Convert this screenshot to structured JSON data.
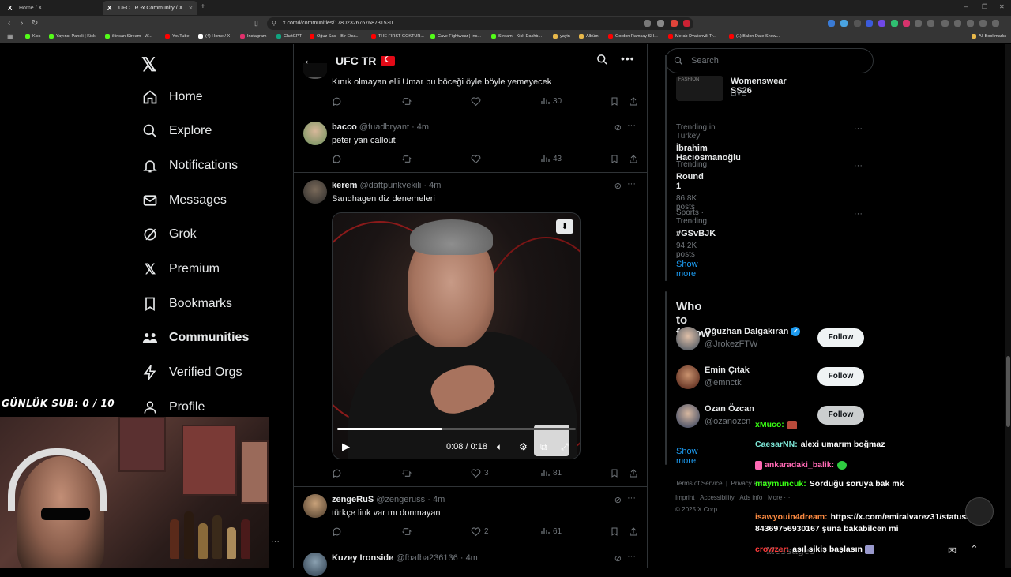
{
  "browser": {
    "tabs": [
      {
        "label": "Home / X",
        "active": false
      },
      {
        "label": "UFC TR •x Community / X",
        "active": true
      }
    ],
    "url": "x.com/i/communities/1780232676768731530",
    "bookmarks": [
      "Kick",
      "Yayıncı Paneli | Kick",
      "ikinsan Stream - W...",
      "YouTube",
      "(4) Home / X",
      "Instagram",
      "ChatGPT",
      "Oğuz Sasi - Bir Efsa...",
      "THE FIRST GOKTUR...",
      "Cave Fightwear | Ins...",
      "Stream - Kick Dashb...",
      "yayin",
      "Albüm",
      "Gordon Ramsay SH...",
      "Merab Dvalishvili Tr...",
      "(1) Balon Date Show...",
      "All Bookmarks"
    ]
  },
  "sidebar": {
    "logo": "𝕏",
    "items": [
      {
        "label": "Home",
        "icon": "home-icon"
      },
      {
        "label": "Explore",
        "icon": "search-icon"
      },
      {
        "label": "Notifications",
        "icon": "bell-icon"
      },
      {
        "label": "Messages",
        "icon": "envelope-icon"
      },
      {
        "label": "Grok",
        "icon": "grok-icon"
      },
      {
        "label": "Premium",
        "icon": "x-icon"
      },
      {
        "label": "Bookmarks",
        "icon": "bookmark-icon"
      },
      {
        "label": "Communities",
        "icon": "people-icon"
      },
      {
        "label": "Verified Orgs",
        "icon": "bolt-icon"
      },
      {
        "label": "Profile",
        "icon": "person-icon"
      }
    ]
  },
  "header": {
    "title": "UFC TR"
  },
  "tweets": [
    {
      "name": "",
      "handle": "",
      "time": "",
      "text": "Kınık olmayan elli Umar bu böceği öyle böyle yemeyecek",
      "replies": "",
      "retweets": "",
      "likes": "",
      "views": "30"
    },
    {
      "name": "bacco",
      "handle": "@fuadbryant",
      "time": "· 4m",
      "text": "peter yan callout",
      "replies": "",
      "retweets": "",
      "likes": "",
      "views": "43"
    },
    {
      "name": "kerem",
      "handle": "@daftpunkvekili",
      "time": "· 4m",
      "text": "Sandhagen diz denemeleri",
      "replies": "",
      "retweets": "",
      "likes": "3",
      "views": "81"
    },
    {
      "name": "zengeRuS",
      "handle": "@zengeruss",
      "time": "· 4m",
      "text": "türkçe link var mı donmayan",
      "replies": "",
      "retweets": "",
      "likes": "2",
      "views": "61"
    },
    {
      "name": "Kuzey Ironside",
      "handle": "@fbafba236136",
      "time": "· 4m",
      "text": "",
      "replies": "",
      "retweets": "",
      "likes": "",
      "views": ""
    }
  ],
  "video": {
    "time": "0:08 / 0:18",
    "progress": 0.44
  },
  "search": {
    "placeholder": "Search"
  },
  "trends": {
    "top": {
      "name": "Womenswear SS26",
      "sub": "LIVE",
      "logo": "FASHION"
    },
    "items": [
      {
        "category": "Trending in Turkey",
        "name": "İbrahim Hacıosmanoğlu",
        "count": ""
      },
      {
        "category": "Trending",
        "name": "Round 1",
        "count": "86.8K posts"
      },
      {
        "category": "Sports · Trending",
        "name": "#GSvBJK",
        "count": "94.2K posts"
      }
    ],
    "show_more": "Show more"
  },
  "who_to_follow": {
    "title": "Who to follow",
    "users": [
      {
        "name": "Oğuzhan Dalgakıran",
        "handle": "@JrokezFTW",
        "verified": true,
        "button": "Follow"
      },
      {
        "name": "Emin Çıtak",
        "handle": "@emnctk",
        "verified": false,
        "button": "Follow"
      },
      {
        "name": "Ozan Özcan",
        "handle": "@ozanozcn",
        "verified": false,
        "button": "Follow"
      }
    ],
    "show_more": "Show more"
  },
  "footer": {
    "line1": [
      "Terms of Service",
      "Privacy Policy"
    ],
    "line2": [
      "Imprint",
      "Accessibility",
      "Ads info",
      "More ···"
    ],
    "copyright": "© 2025 X Corp."
  },
  "stream": {
    "overlay": "GÜNLÜK SUB: 0 / 10",
    "chat": [
      {
        "user": "xMuco:",
        "msg": "",
        "color": "#39ff14",
        "emote": "#b84a3a"
      },
      {
        "user": "CaesarNN:",
        "msg": "alexi umarım boğmaz",
        "color": "#7ee8d8",
        "emote": ""
      },
      {
        "user": "ankaradaki_balik:",
        "msg": "",
        "color": "#ff69b4",
        "emote": "#2ecc40"
      },
      {
        "user": "maymuncuk:",
        "msg": "Sorduğu soruya bak mk",
        "color": "#39ff14",
        "emote": ""
      },
      {
        "user": "isawyouin4dream:",
        "msg": "https://x.com/emiralvarez31/status/19324",
        "color": "#ff8c42",
        "emote": ""
      },
      {
        "user": "",
        "msg": "84369756930167 şuna bakabilcen mi",
        "color": "#ffffff",
        "emote": ""
      },
      {
        "user": "crowzer:",
        "msg": "asıl sikiş başlasın",
        "color": "#ff3b3b",
        "emote": "#9999cc"
      }
    ],
    "messages_label": "Messages"
  }
}
